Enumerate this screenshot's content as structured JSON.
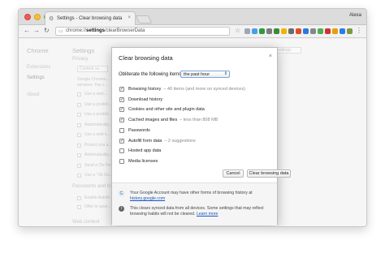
{
  "browser": {
    "tab_title": "Settings - Clear browsing data",
    "tab_close": "×",
    "profile_name": "Alexa",
    "url_prefix": "chrome://",
    "url_strong": "settings",
    "url_rest": "/clearBrowserData",
    "nav": {
      "back": "←",
      "forward": "→",
      "reload": "↻",
      "star": "☆",
      "menu": "⋮"
    },
    "extension_colors": [
      "#9aa7b8",
      "#4a9ee8",
      "#2f9a41",
      "#7c7c7c",
      "#3a8a3a",
      "#f0b400",
      "#6b6b6b",
      "#e04b2a",
      "#2a7ae0",
      "#888888",
      "#4caf50",
      "#cc3333",
      "#e7a000",
      "#2d7be5",
      "#7b9a3c"
    ]
  },
  "settings_bg": {
    "sidebar_title": "Chrome",
    "sidebar_items": [
      "Extensions",
      "Settings",
      "About"
    ],
    "title": "Settings",
    "section_privacy": "Privacy",
    "content_settings_button": "Content se...",
    "google_chrome_text": [
      "Google Chrome...",
      "services. You c..."
    ],
    "check_rows": [
      "Use a web...",
      "Use a predict...",
      "Use a predict...",
      "Automatically...",
      "Use a web s...",
      "Protect you a...",
      "Automatically...",
      "Send a 'Do No...",
      "Use a \"Ok Go..."
    ],
    "section_passwords": "Passwords and fo...",
    "password_rows": [
      "Enable Autofil...",
      "Offer to save..."
    ],
    "section_web": "Web content",
    "search_placeholder": "Search settings"
  },
  "dialog": {
    "title": "Clear browsing data",
    "close": "×",
    "obliterate_label": "Obliterate the following items from:",
    "range_value": "the past hour",
    "options": [
      {
        "label": "Browsing history",
        "note": "– 40 items (and more on synced devices)",
        "checked": true,
        "mark": "✓"
      },
      {
        "label": "Download history",
        "note": "",
        "checked": true,
        "mark": "✓"
      },
      {
        "label": "Cookies and other site and plugin data",
        "note": "",
        "checked": true,
        "mark": "✓"
      },
      {
        "label": "Cached images and files",
        "note": "– less than 808 MB",
        "checked": true,
        "mark": "✓"
      },
      {
        "label": "Passwords",
        "note": "",
        "checked": false,
        "mark": ""
      },
      {
        "label": "Autofill form data",
        "note": "– 2 suggestions",
        "checked": true,
        "mark": "✓"
      },
      {
        "label": "Hosted app data",
        "note": "",
        "checked": false,
        "mark": ""
      },
      {
        "label": "Media licenses",
        "note": "",
        "checked": false,
        "mark": ""
      }
    ],
    "cancel_label": "Cancel",
    "clear_label": "Clear browsing data",
    "footer": {
      "google_icon": "G",
      "google_text": "Your Google Account may have other forms of browsing history at",
      "google_link": "history.google.com",
      "info_icon": "i",
      "sync_text": "This clears synced data from all devices. Some settings that may reflect browsing habits will not be cleared.",
      "learn_more": "Learn more"
    }
  }
}
